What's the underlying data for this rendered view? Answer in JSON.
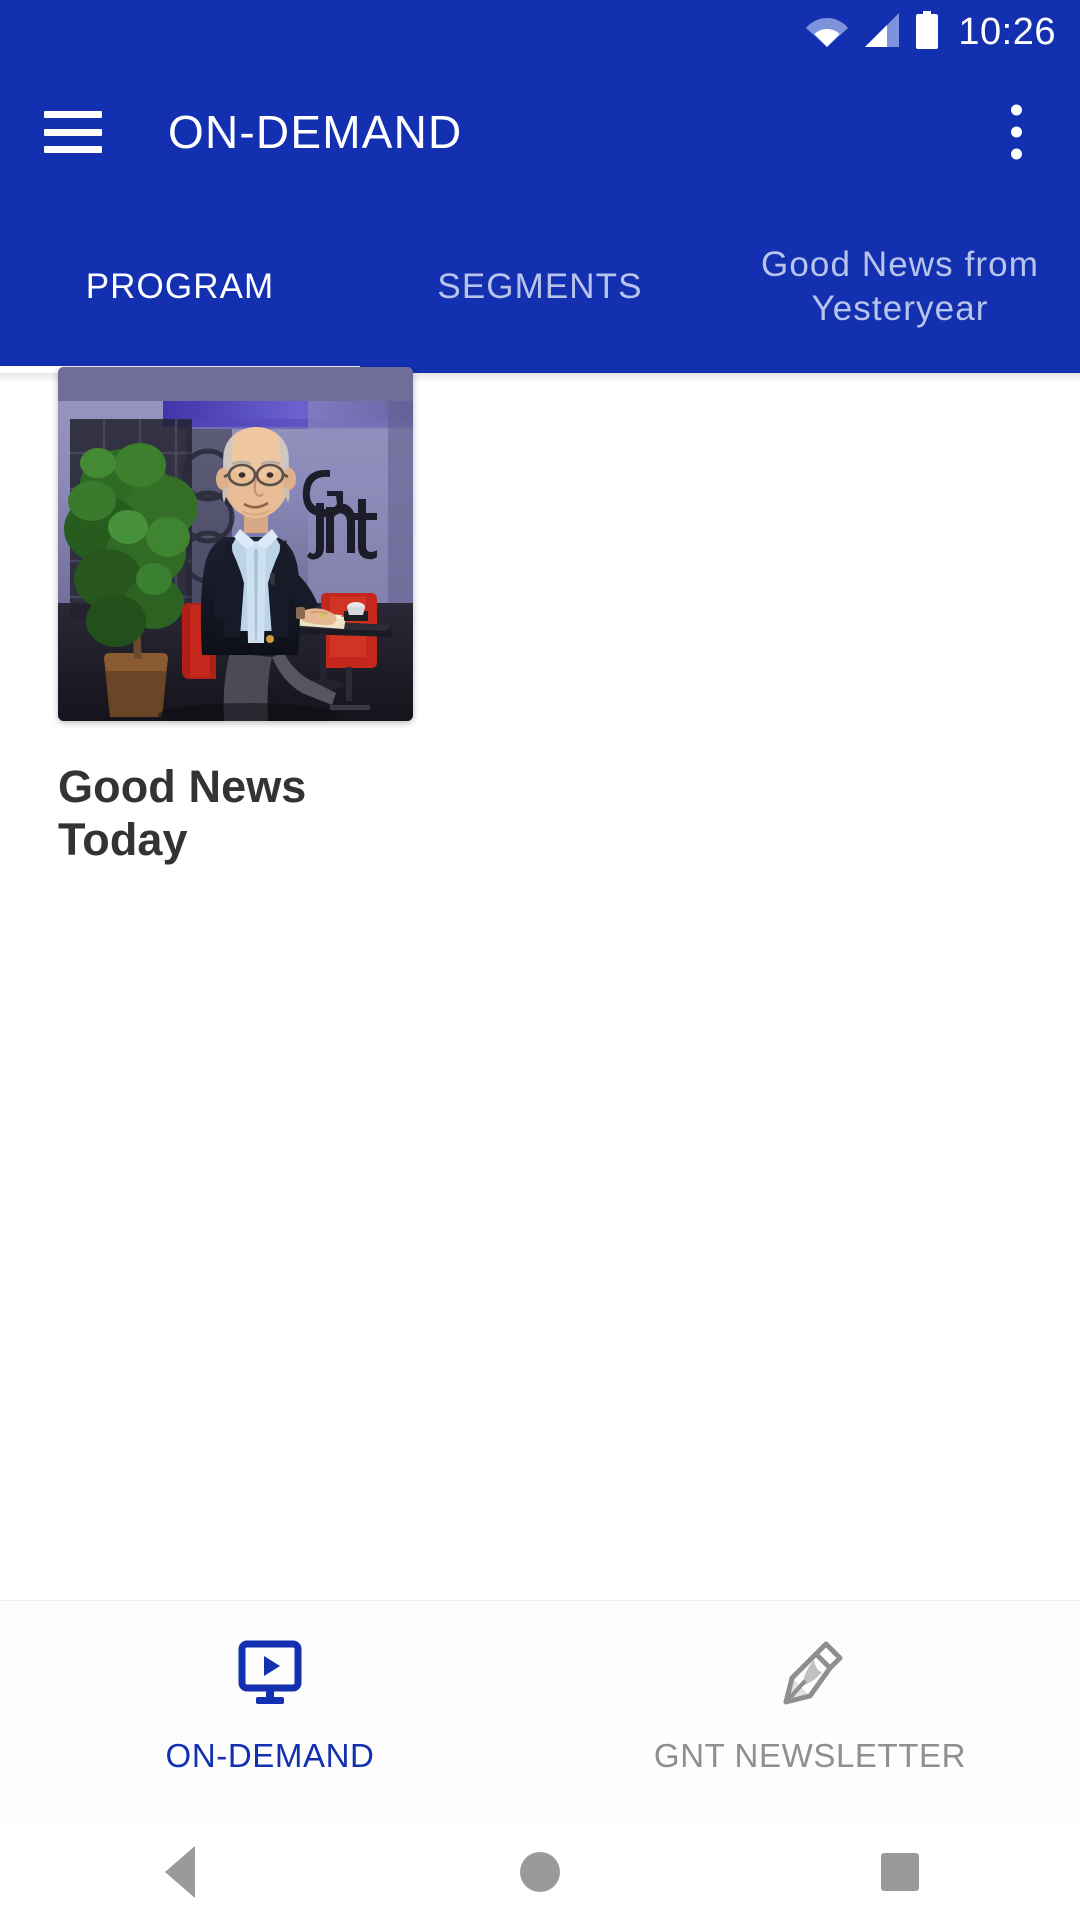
{
  "status_bar": {
    "time": "10:26",
    "icons": [
      "wifi-icon",
      "cellular-signal-icon",
      "battery-icon"
    ]
  },
  "app_bar": {
    "menu_icon": "hamburger-menu-icon",
    "title": "ON-DEMAND",
    "overflow_icon": "more-vertical-icon"
  },
  "tabs": [
    {
      "label": "PROGRAM",
      "active": true
    },
    {
      "label": "SEGMENTS",
      "active": false
    },
    {
      "label": "Good News from Yesteryear",
      "active": false
    }
  ],
  "content": {
    "cards": [
      {
        "title": "Good News Today",
        "thumbnail_alt": "Man in dark suit seated in TV studio with plant and GNT logo"
      }
    ]
  },
  "bottom_nav": [
    {
      "label": "ON-DEMAND",
      "icon": "video-monitor-play-icon",
      "active": true
    },
    {
      "label": "GNT NEWSLETTER",
      "icon": "pen-nib-icon",
      "active": false
    }
  ],
  "android_nav": [
    {
      "name": "back",
      "icon": "back-triangle-icon"
    },
    {
      "name": "home",
      "icon": "home-circle-icon"
    },
    {
      "name": "recents",
      "icon": "recents-square-icon"
    }
  ],
  "colors": {
    "brand_blue": "#1230B0",
    "tab_inactive": "#B9C4EC",
    "title_text": "#333333",
    "nav_inactive": "#8f8f8f"
  }
}
